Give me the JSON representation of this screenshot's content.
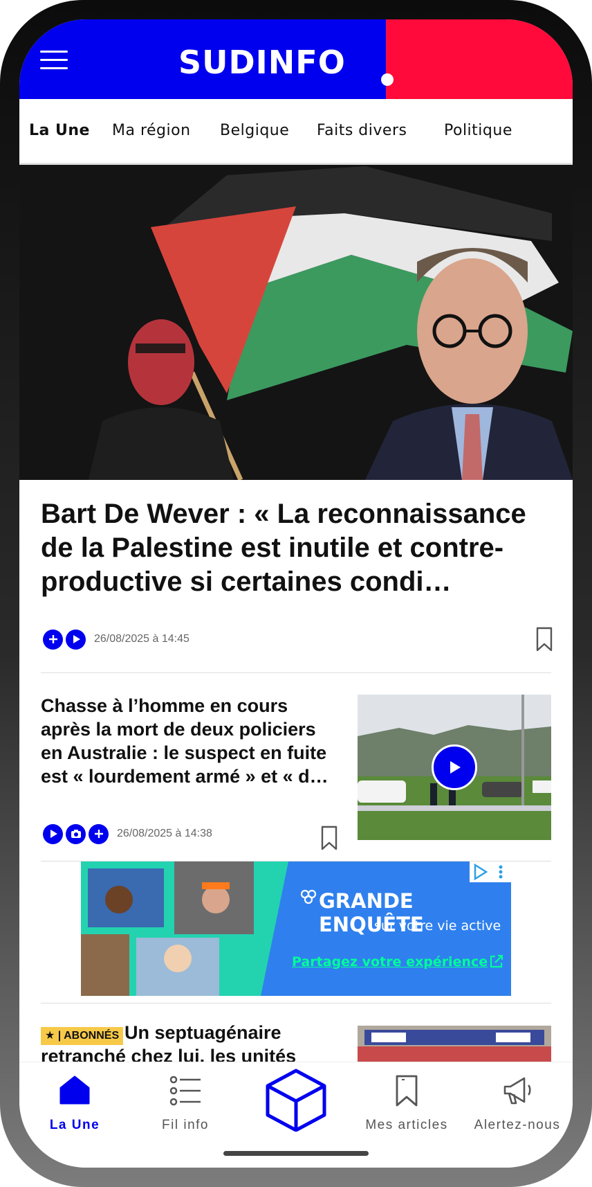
{
  "header": {
    "logo": "SUDINFO",
    "menu_icon": "hamburger-icon"
  },
  "nav": {
    "items": [
      {
        "label": "La Une",
        "active": true
      },
      {
        "label": "Ma région",
        "active": false
      },
      {
        "label": "Belgique",
        "active": false
      },
      {
        "label": "Faits divers",
        "active": false
      },
      {
        "label": "Politique",
        "active": false
      }
    ]
  },
  "articles": [
    {
      "title": "Bart De Wever : « La reconnaissance de la Palestine est inutile et contre-productive si certaines condi…",
      "date": "26/08/2025 à 14:45",
      "icons": [
        "plus-icon",
        "play-icon"
      ]
    },
    {
      "title": "Chasse à l’homme en cours après la mort de deux policiers en Australie : le suspect en fuite est « lourdement armé » et « d…",
      "date": "26/08/2025 à 14:38",
      "icons": [
        "play-icon",
        "camera-icon",
        "plus-icon"
      ]
    },
    {
      "label": "★ | ABONNÉS",
      "title_line1": "Un septuagénaire",
      "title_line2": "retranché chez lui, les unités"
    }
  ],
  "ad": {
    "title": "GRANDE ENQUÊTE",
    "subtitle": "sur votre vie active",
    "cta": "Partagez votre expérience"
  },
  "bottom_nav": [
    {
      "label": "La Une",
      "icon": "home-icon",
      "active": true
    },
    {
      "label": "Fil info",
      "icon": "list-icon",
      "active": false
    },
    {
      "label": "",
      "icon": "cube-icon",
      "active": false
    },
    {
      "label": "Mes articles",
      "icon": "bookmark-icon",
      "active": false
    },
    {
      "label": "Alertez-nous",
      "icon": "megaphone-icon",
      "active": false
    }
  ],
  "colors": {
    "brand_blue": "#0000ee",
    "brand_red": "#ff0a3a",
    "subscriber_yellow": "#f7c948"
  }
}
